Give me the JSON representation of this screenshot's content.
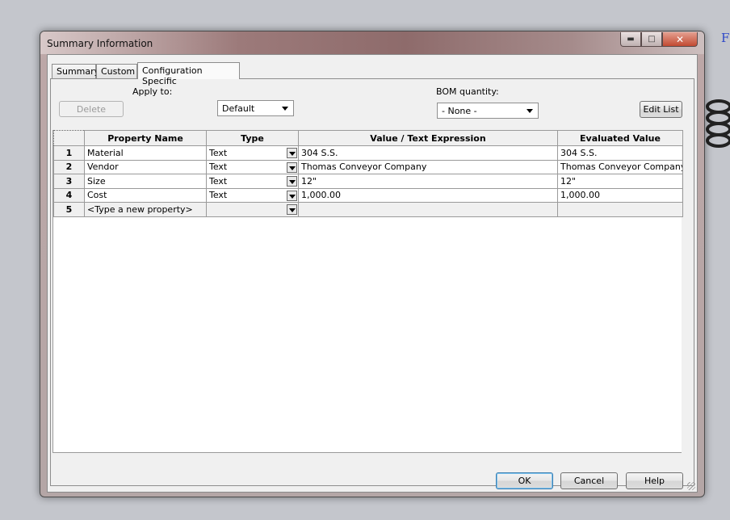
{
  "window": {
    "title": "Summary Information"
  },
  "tabs": [
    {
      "label": "Summary"
    },
    {
      "label": "Custom"
    },
    {
      "label": "Configuration Specific"
    }
  ],
  "form": {
    "apply_to_label": "Apply to:",
    "apply_to_value": "Default",
    "bom_label": "BOM quantity:",
    "bom_value": "- None -",
    "delete_label": "Delete",
    "edit_list_label": "Edit List"
  },
  "table": {
    "headers": [
      "Property Name",
      "Type",
      "Value / Text Expression",
      "Evaluated Value"
    ],
    "rows": [
      {
        "num": "1",
        "name": "Material",
        "type": "Text",
        "value": "304 S.S.",
        "evaluated": "304 S.S."
      },
      {
        "num": "2",
        "name": "Vendor",
        "type": "Text",
        "value": "Thomas Conveyor Company",
        "evaluated": "Thomas Conveyor Company"
      },
      {
        "num": "3",
        "name": "Size",
        "type": "Text",
        "value": "12\"",
        "evaluated": "12\""
      },
      {
        "num": "4",
        "name": "Cost",
        "type": "Text",
        "value": "1,000.00",
        "evaluated": "1,000.00"
      },
      {
        "num": "5",
        "name": "<Type a new property>",
        "type": "",
        "value": "",
        "evaluated": ""
      }
    ]
  },
  "footer": {
    "ok": "OK",
    "cancel": "Cancel",
    "help": "Help"
  },
  "background": {
    "edge_letter": "F"
  },
  "colors": {
    "default_button_border": "#3c7fb1",
    "title_bar": "#9c7a7a",
    "close_button": "#c24a32"
  }
}
